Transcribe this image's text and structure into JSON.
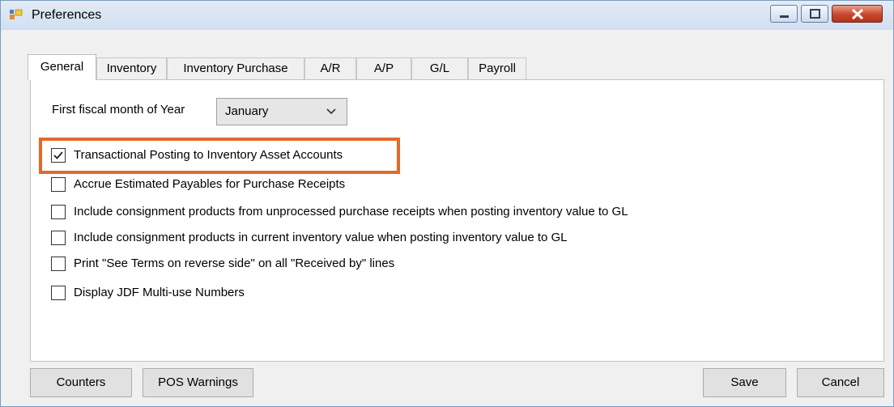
{
  "window": {
    "title": "Preferences",
    "icon": "preferences-app-icon"
  },
  "title_buttons": {
    "minimize": "minimize-icon",
    "maximize": "maximize-icon",
    "close": "close-icon"
  },
  "tabs": [
    {
      "label": "General",
      "active": true
    },
    {
      "label": "Inventory",
      "active": false
    },
    {
      "label": "Inventory Purchase",
      "active": false
    },
    {
      "label": "A/R",
      "active": false
    },
    {
      "label": "A/P",
      "active": false
    },
    {
      "label": "G/L",
      "active": false
    },
    {
      "label": "Payroll",
      "active": false
    }
  ],
  "general": {
    "fiscal_label": "First fiscal month of Year",
    "fiscal_month": "January",
    "options": [
      {
        "label": "Transactional Posting to Inventory Asset Accounts",
        "checked": true,
        "highlighted": true
      },
      {
        "label": "Accrue Estimated Payables for Purchase Receipts",
        "checked": false
      },
      {
        "label": "Include consignment products from unprocessed purchase receipts when posting inventory value to GL",
        "checked": false
      },
      {
        "label": "Include consignment products in current inventory value when posting inventory value to GL",
        "checked": false
      },
      {
        "label": "Print \"See Terms on reverse side\" on all \"Received by\" lines",
        "checked": false
      },
      {
        "label": "Display JDF Multi-use Numbers",
        "checked": false
      }
    ]
  },
  "buttons": {
    "counters": "Counters",
    "pos_warnings": "POS Warnings",
    "save": "Save",
    "cancel": "Cancel"
  },
  "colors": {
    "highlight": "#e06a2a",
    "titlebar": "#d2def0",
    "close": "#c9462c"
  }
}
